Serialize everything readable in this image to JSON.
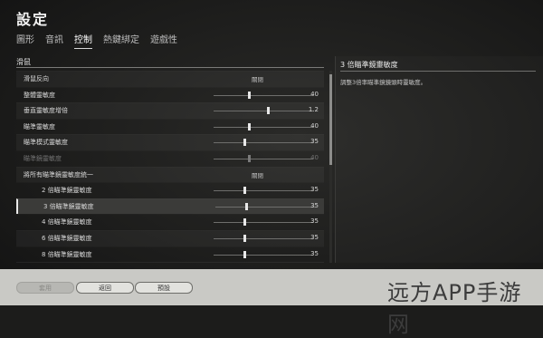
{
  "window": {
    "title": "設定"
  },
  "tabs": [
    {
      "label": "圖形",
      "active": false
    },
    {
      "label": "音訊",
      "active": false
    },
    {
      "label": "控制",
      "active": true
    },
    {
      "label": "熱鍵綁定",
      "active": false
    },
    {
      "label": "遊戲性",
      "active": false
    }
  ],
  "section": {
    "title": "滑鼠"
  },
  "settings": [
    {
      "label": "滑鼠反向",
      "type": "toggle",
      "value": "關閉",
      "indent": false,
      "disabled": false
    },
    {
      "label": "整體靈敏度",
      "type": "slider",
      "value": "40",
      "fraction": 0.36,
      "indent": false,
      "disabled": false
    },
    {
      "label": "垂直靈敏度增倍",
      "type": "slider",
      "value": "1.2",
      "fraction": 0.55,
      "indent": false,
      "disabled": false
    },
    {
      "label": "瞄準靈敏度",
      "type": "slider",
      "value": "40",
      "fraction": 0.36,
      "indent": false,
      "disabled": false
    },
    {
      "label": "瞄準模式靈敏度",
      "type": "slider",
      "value": "35",
      "fraction": 0.31,
      "indent": false,
      "disabled": false
    },
    {
      "label": "瞄準鏡靈敏度",
      "type": "slider",
      "value": "40",
      "fraction": 0.36,
      "indent": false,
      "disabled": true
    },
    {
      "label": "將所有瞄準鏡靈敏度統一",
      "type": "toggle",
      "value": "關閉",
      "indent": false,
      "disabled": false
    },
    {
      "label": "2 倍瞄準鏡靈敏度",
      "type": "slider",
      "value": "35",
      "fraction": 0.31,
      "indent": true,
      "disabled": false
    },
    {
      "label": "3 倍瞄準鏡靈敏度",
      "type": "slider",
      "value": "35",
      "fraction": 0.31,
      "indent": true,
      "disabled": false,
      "selected": true
    },
    {
      "label": "4 倍瞄準鏡靈敏度",
      "type": "slider",
      "value": "35",
      "fraction": 0.31,
      "indent": true,
      "disabled": false
    },
    {
      "label": "6 倍瞄準鏡靈敏度",
      "type": "slider",
      "value": "35",
      "fraction": 0.31,
      "indent": true,
      "disabled": false
    },
    {
      "label": "8 倍瞄準鏡靈敏度",
      "type": "slider",
      "value": "35",
      "fraction": 0.31,
      "indent": true,
      "disabled": false
    },
    {
      "label": "15 倍瞄準鏡靈敏度",
      "type": "slider",
      "value": "35",
      "fraction": 0.31,
      "indent": true,
      "disabled": false
    }
  ],
  "description": {
    "title": "3 倍瞄準鏡靈敏度",
    "text": "調整3倍率瞄準鏡鏡頭時靈敏度。"
  },
  "footer": {
    "apply_label": "套用",
    "back_label": "返回",
    "preset_label": "預設"
  },
  "watermark": {
    "text": "远方APP手游网"
  }
}
